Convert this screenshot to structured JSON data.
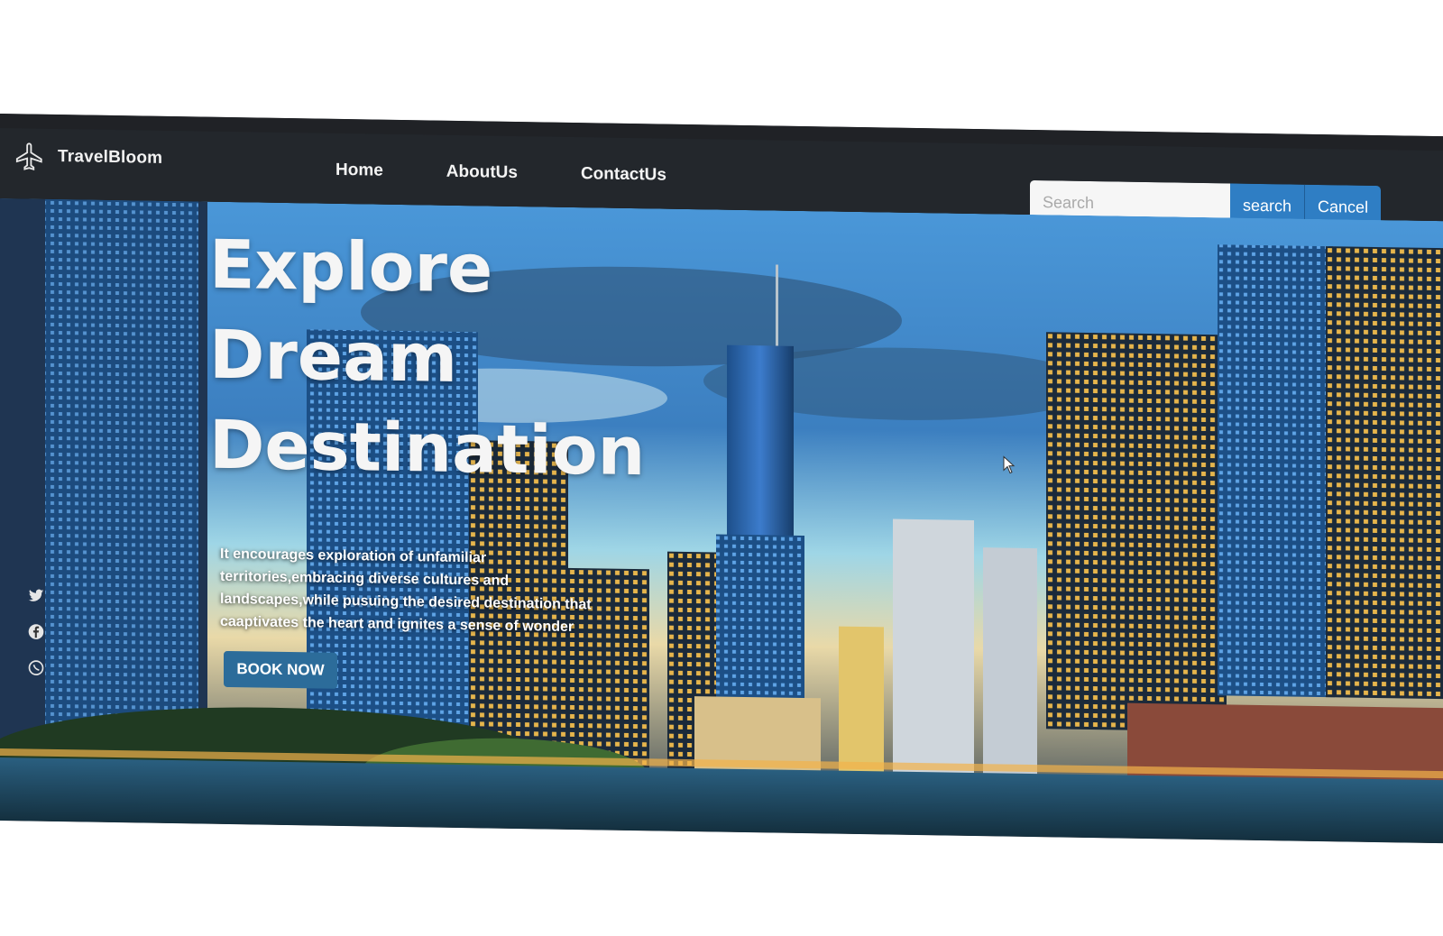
{
  "brand": {
    "name": "TravelBloom",
    "icon": "airplane-icon"
  },
  "nav": {
    "items": [
      "Home",
      "AboutUs",
      "ContactUs"
    ]
  },
  "search": {
    "placeholder": "Search",
    "value": "",
    "search_label": "search",
    "cancel_label": "Cancel"
  },
  "hero": {
    "headline": [
      "Explore",
      "Dream",
      "Destination"
    ],
    "tagline": "It encourages exploration of unfamiliar territories,embracing diverse cultures and landscapes,while pusuing the desired destination that caaptivates the heart and ignites a sense of wonder",
    "cta_label": "BOOK NOW"
  },
  "browser": {
    "icons": [
      "star-icon",
      "download-icon"
    ]
  },
  "socials": [
    "twitter-icon",
    "facebook-icon",
    "whatsapp-icon"
  ],
  "colors": {
    "header_bg": "#23272c",
    "accent": "#2f7ec4",
    "cta": "#2c6c9a"
  }
}
